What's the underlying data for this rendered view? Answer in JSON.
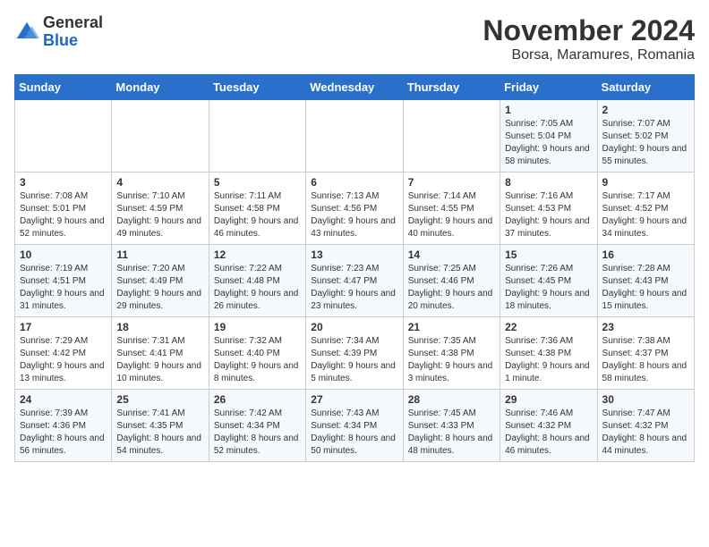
{
  "logo": {
    "general": "General",
    "blue": "Blue"
  },
  "title": "November 2024",
  "subtitle": "Borsa, Maramures, Romania",
  "days_of_week": [
    "Sunday",
    "Monday",
    "Tuesday",
    "Wednesday",
    "Thursday",
    "Friday",
    "Saturday"
  ],
  "weeks": [
    [
      {
        "day": "",
        "content": ""
      },
      {
        "day": "",
        "content": ""
      },
      {
        "day": "",
        "content": ""
      },
      {
        "day": "",
        "content": ""
      },
      {
        "day": "",
        "content": ""
      },
      {
        "day": "1",
        "content": "Sunrise: 7:05 AM\nSunset: 5:04 PM\nDaylight: 9 hours and 58 minutes."
      },
      {
        "day": "2",
        "content": "Sunrise: 7:07 AM\nSunset: 5:02 PM\nDaylight: 9 hours and 55 minutes."
      }
    ],
    [
      {
        "day": "3",
        "content": "Sunrise: 7:08 AM\nSunset: 5:01 PM\nDaylight: 9 hours and 52 minutes."
      },
      {
        "day": "4",
        "content": "Sunrise: 7:10 AM\nSunset: 4:59 PM\nDaylight: 9 hours and 49 minutes."
      },
      {
        "day": "5",
        "content": "Sunrise: 7:11 AM\nSunset: 4:58 PM\nDaylight: 9 hours and 46 minutes."
      },
      {
        "day": "6",
        "content": "Sunrise: 7:13 AM\nSunset: 4:56 PM\nDaylight: 9 hours and 43 minutes."
      },
      {
        "day": "7",
        "content": "Sunrise: 7:14 AM\nSunset: 4:55 PM\nDaylight: 9 hours and 40 minutes."
      },
      {
        "day": "8",
        "content": "Sunrise: 7:16 AM\nSunset: 4:53 PM\nDaylight: 9 hours and 37 minutes."
      },
      {
        "day": "9",
        "content": "Sunrise: 7:17 AM\nSunset: 4:52 PM\nDaylight: 9 hours and 34 minutes."
      }
    ],
    [
      {
        "day": "10",
        "content": "Sunrise: 7:19 AM\nSunset: 4:51 PM\nDaylight: 9 hours and 31 minutes."
      },
      {
        "day": "11",
        "content": "Sunrise: 7:20 AM\nSunset: 4:49 PM\nDaylight: 9 hours and 29 minutes."
      },
      {
        "day": "12",
        "content": "Sunrise: 7:22 AM\nSunset: 4:48 PM\nDaylight: 9 hours and 26 minutes."
      },
      {
        "day": "13",
        "content": "Sunrise: 7:23 AM\nSunset: 4:47 PM\nDaylight: 9 hours and 23 minutes."
      },
      {
        "day": "14",
        "content": "Sunrise: 7:25 AM\nSunset: 4:46 PM\nDaylight: 9 hours and 20 minutes."
      },
      {
        "day": "15",
        "content": "Sunrise: 7:26 AM\nSunset: 4:45 PM\nDaylight: 9 hours and 18 minutes."
      },
      {
        "day": "16",
        "content": "Sunrise: 7:28 AM\nSunset: 4:43 PM\nDaylight: 9 hours and 15 minutes."
      }
    ],
    [
      {
        "day": "17",
        "content": "Sunrise: 7:29 AM\nSunset: 4:42 PM\nDaylight: 9 hours and 13 minutes."
      },
      {
        "day": "18",
        "content": "Sunrise: 7:31 AM\nSunset: 4:41 PM\nDaylight: 9 hours and 10 minutes."
      },
      {
        "day": "19",
        "content": "Sunrise: 7:32 AM\nSunset: 4:40 PM\nDaylight: 9 hours and 8 minutes."
      },
      {
        "day": "20",
        "content": "Sunrise: 7:34 AM\nSunset: 4:39 PM\nDaylight: 9 hours and 5 minutes."
      },
      {
        "day": "21",
        "content": "Sunrise: 7:35 AM\nSunset: 4:38 PM\nDaylight: 9 hours and 3 minutes."
      },
      {
        "day": "22",
        "content": "Sunrise: 7:36 AM\nSunset: 4:38 PM\nDaylight: 9 hours and 1 minute."
      },
      {
        "day": "23",
        "content": "Sunrise: 7:38 AM\nSunset: 4:37 PM\nDaylight: 8 hours and 58 minutes."
      }
    ],
    [
      {
        "day": "24",
        "content": "Sunrise: 7:39 AM\nSunset: 4:36 PM\nDaylight: 8 hours and 56 minutes."
      },
      {
        "day": "25",
        "content": "Sunrise: 7:41 AM\nSunset: 4:35 PM\nDaylight: 8 hours and 54 minutes."
      },
      {
        "day": "26",
        "content": "Sunrise: 7:42 AM\nSunset: 4:34 PM\nDaylight: 8 hours and 52 minutes."
      },
      {
        "day": "27",
        "content": "Sunrise: 7:43 AM\nSunset: 4:34 PM\nDaylight: 8 hours and 50 minutes."
      },
      {
        "day": "28",
        "content": "Sunrise: 7:45 AM\nSunset: 4:33 PM\nDaylight: 8 hours and 48 minutes."
      },
      {
        "day": "29",
        "content": "Sunrise: 7:46 AM\nSunset: 4:32 PM\nDaylight: 8 hours and 46 minutes."
      },
      {
        "day": "30",
        "content": "Sunrise: 7:47 AM\nSunset: 4:32 PM\nDaylight: 8 hours and 44 minutes."
      }
    ]
  ]
}
